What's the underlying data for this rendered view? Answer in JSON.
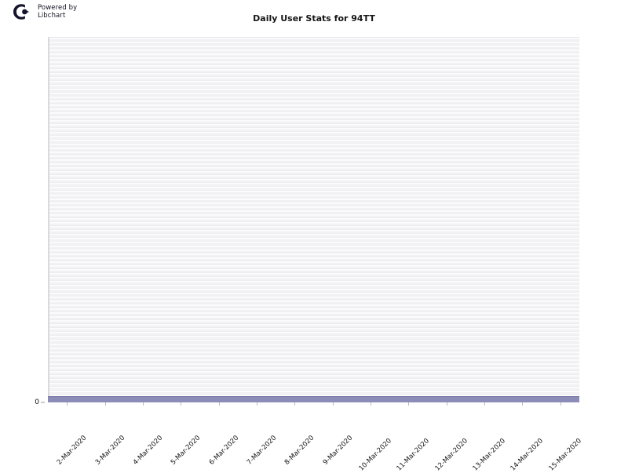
{
  "branding": {
    "logo_icon": "libchart-logo-icon",
    "text": "Powered by\nLibchart",
    "line1": "Powered by",
    "line2": "Libchart"
  },
  "chart_data": {
    "type": "bar",
    "title": "Daily User Stats for 94TT",
    "xlabel": "",
    "ylabel": "",
    "categories": [
      "2-Mar-2020",
      "3-Mar-2020",
      "4-Mar-2020",
      "5-Mar-2020",
      "6-Mar-2020",
      "7-Mar-2020",
      "8-Mar-2020",
      "9-Mar-2020",
      "10-Mar-2020",
      "11-Mar-2020",
      "12-Mar-2020",
      "13-Mar-2020",
      "14-Mar-2020",
      "15-Mar-2020"
    ],
    "values": [
      0,
      0,
      0,
      0,
      0,
      0,
      0,
      0,
      0,
      0,
      0,
      0,
      0,
      0
    ],
    "ylim": [
      0,
      0
    ],
    "yticks": [
      "0"
    ],
    "grid": true,
    "legend": "none",
    "series_color": "#8c8cb8",
    "plot_background": "#f4f4f6",
    "gridline_color": "#ededf0"
  }
}
